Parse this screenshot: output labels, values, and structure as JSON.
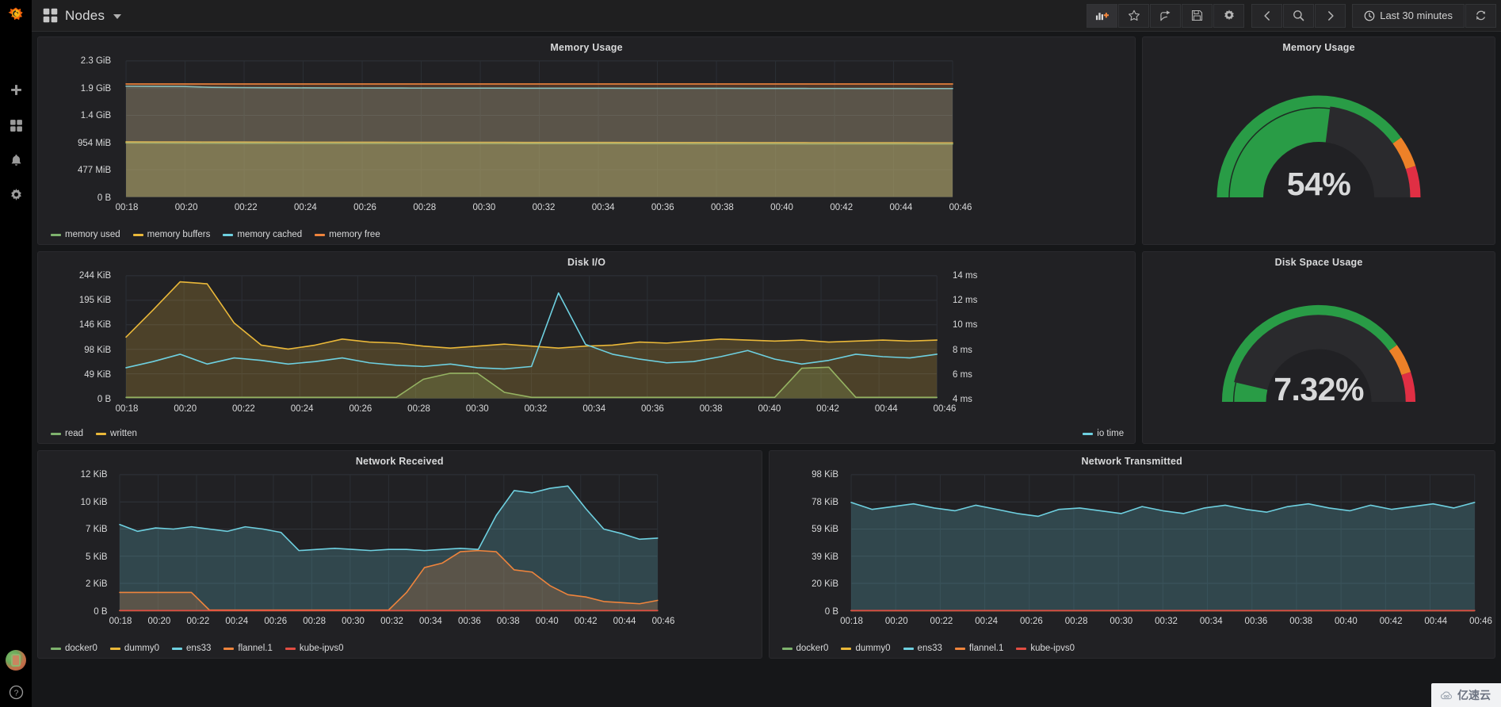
{
  "app": {
    "logo_icon": "grafana-logo-icon",
    "watermark_text": "亿速云",
    "watermark_icon": "cloud-icon"
  },
  "sidebar": {
    "items": [
      {
        "icon": "plus-icon",
        "name": "create"
      },
      {
        "icon": "dashboards-icon",
        "name": "dashboards"
      },
      {
        "icon": "bell-icon",
        "name": "alerting"
      },
      {
        "icon": "gear-icon",
        "name": "configuration"
      }
    ],
    "bottom": [
      {
        "icon": "avatar-icon",
        "name": "user-avatar"
      },
      {
        "icon": "help-icon",
        "name": "help"
      }
    ]
  },
  "topnav": {
    "dashboard_icon": "dashboard-grid-icon",
    "title": "Nodes",
    "caret": "chevron-down-icon",
    "buttons": [
      {
        "name": "add-panel",
        "icon": "add-panel-icon",
        "label": ""
      },
      {
        "name": "mark-favorite",
        "icon": "star-icon",
        "label": ""
      },
      {
        "name": "share-dashboard",
        "icon": "share-icon",
        "label": ""
      },
      {
        "name": "save-dashboard",
        "icon": "save-icon",
        "label": ""
      },
      {
        "name": "dashboard-settings",
        "icon": "gear-icon",
        "label": ""
      },
      {
        "name": "time-range-back",
        "icon": "chevron-left-icon",
        "label": ""
      },
      {
        "name": "zoom-out-time",
        "icon": "search-icon",
        "label": ""
      },
      {
        "name": "time-range-forward",
        "icon": "chevron-right-icon",
        "label": ""
      }
    ],
    "time_range": {
      "icon": "clock-icon",
      "label": "Last 30 minutes"
    },
    "refresh": {
      "icon": "refresh-icon",
      "label": ""
    }
  },
  "colors": {
    "green": "#7eb26d",
    "yellow": "#eab839",
    "cyan": "#6ed0e0",
    "orange": "#ef843c",
    "red": "#e24d42",
    "gauge_green": "#299c46",
    "gauge_orange": "#ed8128",
    "gauge_red": "#e02f44",
    "panel_bg": "#212124",
    "page_bg": "#161719"
  },
  "panels": {
    "memory_usage_graph": {
      "title": "Memory Usage"
    },
    "memory_usage_gauge": {
      "title": "Memory Usage",
      "value": "54%",
      "percent": 54
    },
    "disk_io": {
      "title": "Disk I/O"
    },
    "disk_space_gauge": {
      "title": "Disk Space Usage",
      "value": "7.32%",
      "percent": 7.32
    },
    "network_received": {
      "title": "Network Received"
    },
    "network_transmitted": {
      "title": "Network Transmitted"
    }
  },
  "chart_data": [
    {
      "id": "memory_usage_graph",
      "type": "area",
      "title": "Memory Usage",
      "xlabel": "",
      "ylabel": "",
      "ytick_labels": [
        "2.3 GiB",
        "1.9 GiB",
        "1.4 GiB",
        "954 MiB",
        "477 MiB",
        "0 B"
      ],
      "ytick_values": [
        2468,
        2048,
        1536,
        954,
        477,
        0
      ],
      "ylim": [
        0,
        2468
      ],
      "xtick_labels": [
        "00:18",
        "00:20",
        "00:22",
        "00:24",
        "00:26",
        "00:28",
        "00:30",
        "00:32",
        "00:34",
        "00:36",
        "00:38",
        "00:40",
        "00:42",
        "00:44",
        "00:46"
      ],
      "grid": true,
      "legend": {
        "position": "bottom-left"
      },
      "series": [
        {
          "name": "memory used",
          "color": "#7eb26d",
          "values": [
            980,
            978,
            976,
            975,
            974,
            973,
            972,
            972,
            971,
            971,
            970,
            970,
            969,
            969,
            968,
            968,
            967,
            967,
            966,
            966,
            965,
            965,
            964,
            964,
            963,
            963,
            962,
            962,
            961,
            961
          ]
        },
        {
          "name": "memory buffers",
          "color": "#eab839",
          "values": [
            1000,
            999,
            998,
            997,
            996,
            995,
            994,
            994,
            993,
            993,
            992,
            992,
            991,
            991,
            990,
            990,
            989,
            989,
            988,
            988,
            987,
            987,
            986,
            986,
            985,
            985,
            984,
            984,
            983,
            983
          ]
        },
        {
          "name": "memory cached",
          "color": "#6ed0e0",
          "values": [
            2010,
            2008,
            2006,
            1990,
            1985,
            1982,
            1980,
            1979,
            1978,
            1977,
            1976,
            1976,
            1975,
            1975,
            1974,
            1974,
            1973,
            1973,
            1972,
            1972,
            1971,
            1971,
            1970,
            1970,
            1969,
            1969,
            1968,
            1968,
            1967,
            1967
          ]
        },
        {
          "name": "memory free",
          "color": "#ef843c",
          "values": [
            2050,
            2050,
            2050,
            2050,
            2050,
            2050,
            2050,
            2050,
            2050,
            2050,
            2050,
            2050,
            2050,
            2050,
            2050,
            2050,
            2050,
            2050,
            2050,
            2050,
            2050,
            2050,
            2050,
            2050,
            2050,
            2050,
            2050,
            2050,
            2050,
            2050
          ]
        }
      ]
    },
    {
      "id": "disk_io",
      "type": "area",
      "title": "Disk I/O",
      "ytick_labels": [
        "244 KiB",
        "195 KiB",
        "146 KiB",
        "98 KiB",
        "49 KiB",
        "0 B"
      ],
      "ytick_values": [
        244,
        195,
        146,
        98,
        49,
        0
      ],
      "ylim": [
        0,
        244
      ],
      "y2tick_labels": [
        "14 ms",
        "12 ms",
        "10 ms",
        "8 ms",
        "6 ms",
        "4 ms"
      ],
      "y2tick_values": [
        14,
        12,
        10,
        8,
        6,
        4
      ],
      "y2lim": [
        4,
        14
      ],
      "xtick_labels": [
        "00:18",
        "00:20",
        "00:22",
        "00:24",
        "00:26",
        "00:28",
        "00:30",
        "00:32",
        "00:34",
        "00:36",
        "00:38",
        "00:40",
        "00:42",
        "00:44",
        "00:46"
      ],
      "grid": true,
      "legend": {
        "position": "bottom-split"
      },
      "series": [
        {
          "name": "read",
          "color": "#7eb26d",
          "axis": "left",
          "values": [
            2,
            2,
            2,
            2,
            2,
            2,
            2,
            2,
            2,
            2,
            2,
            38,
            50,
            50,
            12,
            2,
            2,
            2,
            2,
            2,
            2,
            2,
            2,
            2,
            2,
            60,
            62,
            2,
            2,
            2,
            2
          ]
        },
        {
          "name": "written",
          "color": "#eab839",
          "axis": "left",
          "values": [
            122,
            176,
            232,
            228,
            150,
            106,
            98,
            106,
            118,
            112,
            110,
            104,
            100,
            104,
            108,
            104,
            100,
            104,
            106,
            112,
            110,
            114,
            118,
            116,
            114,
            116,
            112,
            114,
            116,
            114,
            116
          ]
        },
        {
          "name": "io time",
          "color": "#6ed0e0",
          "axis": "right",
          "values": [
            6.5,
            7.0,
            7.6,
            6.8,
            7.3,
            7.1,
            6.8,
            7.0,
            7.3,
            6.9,
            6.7,
            6.6,
            6.8,
            6.5,
            6.4,
            6.6,
            12.6,
            8.4,
            7.6,
            7.2,
            6.9,
            7.0,
            7.4,
            7.9,
            7.2,
            6.8,
            7.1,
            7.6,
            7.4,
            7.3,
            7.6
          ]
        }
      ]
    },
    {
      "id": "memory_usage_gauge",
      "type": "gauge",
      "title": "Memory Usage",
      "value": 54,
      "display": "54%",
      "min": 0,
      "max": 100,
      "thresholds": [
        {
          "from": 0,
          "to": 80,
          "color": "#299c46"
        },
        {
          "from": 80,
          "to": 90,
          "color": "#ed8128"
        },
        {
          "from": 90,
          "to": 100,
          "color": "#e02f44"
        }
      ]
    },
    {
      "id": "disk_space_gauge",
      "type": "gauge",
      "title": "Disk Space Usage",
      "value": 7.32,
      "display": "7.32%",
      "min": 0,
      "max": 100,
      "thresholds": [
        {
          "from": 0,
          "to": 80,
          "color": "#299c46"
        },
        {
          "from": 80,
          "to": 90,
          "color": "#ed8128"
        },
        {
          "from": 90,
          "to": 100,
          "color": "#e02f44"
        }
      ]
    },
    {
      "id": "network_received",
      "type": "area",
      "title": "Network Received",
      "ytick_labels": [
        "12 KiB",
        "10 KiB",
        "7 KiB",
        "5 KiB",
        "2 KiB",
        "0 B"
      ],
      "ytick_values": [
        12,
        10,
        7.5,
        5,
        2.5,
        0
      ],
      "ylim": [
        0,
        12
      ],
      "xtick_labels": [
        "00:18",
        "00:20",
        "00:22",
        "00:24",
        "00:26",
        "00:28",
        "00:30",
        "00:32",
        "00:34",
        "00:36",
        "00:38",
        "00:40",
        "00:42",
        "00:44",
        "00:46"
      ],
      "grid": true,
      "legend": {
        "position": "bottom-left"
      },
      "series": [
        {
          "name": "docker0",
          "color": "#7eb26d",
          "values": [
            0,
            0,
            0,
            0,
            0,
            0,
            0,
            0,
            0,
            0,
            0,
            0,
            0,
            0,
            0,
            0,
            0,
            0,
            0,
            0,
            0,
            0,
            0,
            0,
            0,
            0,
            0,
            0,
            0,
            0,
            0
          ]
        },
        {
          "name": "dummy0",
          "color": "#eab839",
          "values": [
            0,
            0,
            0,
            0,
            0,
            0,
            0,
            0,
            0,
            0,
            0,
            0,
            0,
            0,
            0,
            0,
            0,
            0,
            0,
            0,
            0,
            0,
            0,
            0,
            0,
            0,
            0,
            0,
            0,
            0,
            0
          ]
        },
        {
          "name": "ens33",
          "color": "#6ed0e0",
          "values": [
            7.6,
            7.0,
            7.3,
            7.2,
            7.4,
            7.2,
            7.0,
            7.4,
            7.2,
            6.9,
            5.3,
            5.4,
            5.5,
            5.4,
            5.3,
            5.4,
            5.4,
            5.3,
            5.4,
            5.5,
            5.4,
            8.4,
            10.6,
            10.4,
            10.8,
            11.0,
            9.0,
            7.2,
            6.8,
            6.3,
            6.4
          ]
        },
        {
          "name": "flannel.1",
          "color": "#ef843c",
          "values": [
            1.6,
            1.6,
            1.6,
            1.6,
            1.6,
            0.05,
            0.05,
            0.05,
            0.05,
            0.05,
            0.05,
            0.05,
            0.05,
            0.05,
            0.05,
            0.05,
            1.6,
            3.8,
            4.2,
            5.2,
            5.3,
            5.2,
            3.6,
            3.4,
            2.2,
            1.4,
            1.2,
            0.8,
            0.7,
            0.6,
            0.9
          ]
        },
        {
          "name": "kube-ipvs0",
          "color": "#e24d42",
          "values": [
            0,
            0,
            0,
            0,
            0,
            0,
            0,
            0,
            0,
            0,
            0,
            0,
            0,
            0,
            0,
            0,
            0,
            0,
            0,
            0,
            0,
            0,
            0,
            0,
            0,
            0,
            0,
            0,
            0,
            0,
            0
          ]
        }
      ]
    },
    {
      "id": "network_transmitted",
      "type": "area",
      "title": "Network Transmitted",
      "ytick_labels": [
        "98 KiB",
        "78 KiB",
        "59 KiB",
        "39 KiB",
        "20 KiB",
        "0 B"
      ],
      "ytick_values": [
        98,
        78,
        59,
        39,
        20,
        0
      ],
      "ylim": [
        0,
        98
      ],
      "xtick_labels": [
        "00:18",
        "00:20",
        "00:22",
        "00:24",
        "00:26",
        "00:28",
        "00:30",
        "00:32",
        "00:34",
        "00:36",
        "00:38",
        "00:40",
        "00:42",
        "00:44",
        "00:46"
      ],
      "grid": true,
      "legend": {
        "position": "bottom-left"
      },
      "series": [
        {
          "name": "docker0",
          "color": "#7eb26d",
          "values": [
            0,
            0,
            0,
            0,
            0,
            0,
            0,
            0,
            0,
            0,
            0,
            0,
            0,
            0,
            0,
            0,
            0,
            0,
            0,
            0,
            0,
            0,
            0,
            0,
            0,
            0,
            0,
            0,
            0,
            0,
            0
          ]
        },
        {
          "name": "dummy0",
          "color": "#eab839",
          "values": [
            0,
            0,
            0,
            0,
            0,
            0,
            0,
            0,
            0,
            0,
            0,
            0,
            0,
            0,
            0,
            0,
            0,
            0,
            0,
            0,
            0,
            0,
            0,
            0,
            0,
            0,
            0,
            0,
            0,
            0,
            0
          ]
        },
        {
          "name": "ens33",
          "color": "#6ed0e0",
          "values": [
            78,
            73,
            75,
            77,
            74,
            72,
            76,
            73,
            70,
            68,
            73,
            74,
            72,
            70,
            75,
            72,
            70,
            74,
            76,
            73,
            71,
            75,
            77,
            74,
            72,
            76,
            73,
            75,
            77,
            74,
            78
          ]
        },
        {
          "name": "flannel.1",
          "color": "#ef843c",
          "values": [
            0,
            0,
            0,
            0,
            0,
            0,
            0,
            0,
            0,
            0,
            0,
            0,
            0,
            0,
            0,
            0,
            0,
            0,
            0,
            0,
            0,
            0,
            0,
            0,
            0,
            0,
            0,
            0,
            0,
            0,
            0
          ]
        },
        {
          "name": "kube-ipvs0",
          "color": "#e24d42",
          "values": [
            0,
            0,
            0,
            0,
            0,
            0,
            0,
            0,
            0,
            0,
            0,
            0,
            0,
            0,
            0,
            0,
            0,
            0,
            0,
            0,
            0,
            0,
            0,
            0,
            0,
            0,
            0,
            0,
            0,
            0,
            0
          ]
        }
      ]
    }
  ]
}
